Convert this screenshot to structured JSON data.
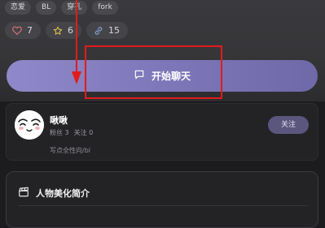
{
  "tags": [
    "恋爱",
    "BL",
    "穿孔",
    "fork"
  ],
  "stats": {
    "likes": "7",
    "stars": "6",
    "links": "15"
  },
  "chat_button": {
    "label": "开始聊天"
  },
  "profile": {
    "name": "啾啾",
    "fans": "粉丝 3",
    "following": "关注 0",
    "description": "写点全性向/bl",
    "follow_label": "关注"
  },
  "intro": {
    "title": "人物美化简介"
  },
  "colors": {
    "accent": "#7e77b9",
    "annotation": "#e21b1b",
    "background": "#1c1c1f"
  },
  "icons": {
    "likes": "heart-icon",
    "stars": "star-icon",
    "links": "link-icon",
    "chat": "chat-bubble-icon",
    "intro": "clapperboard-icon"
  }
}
